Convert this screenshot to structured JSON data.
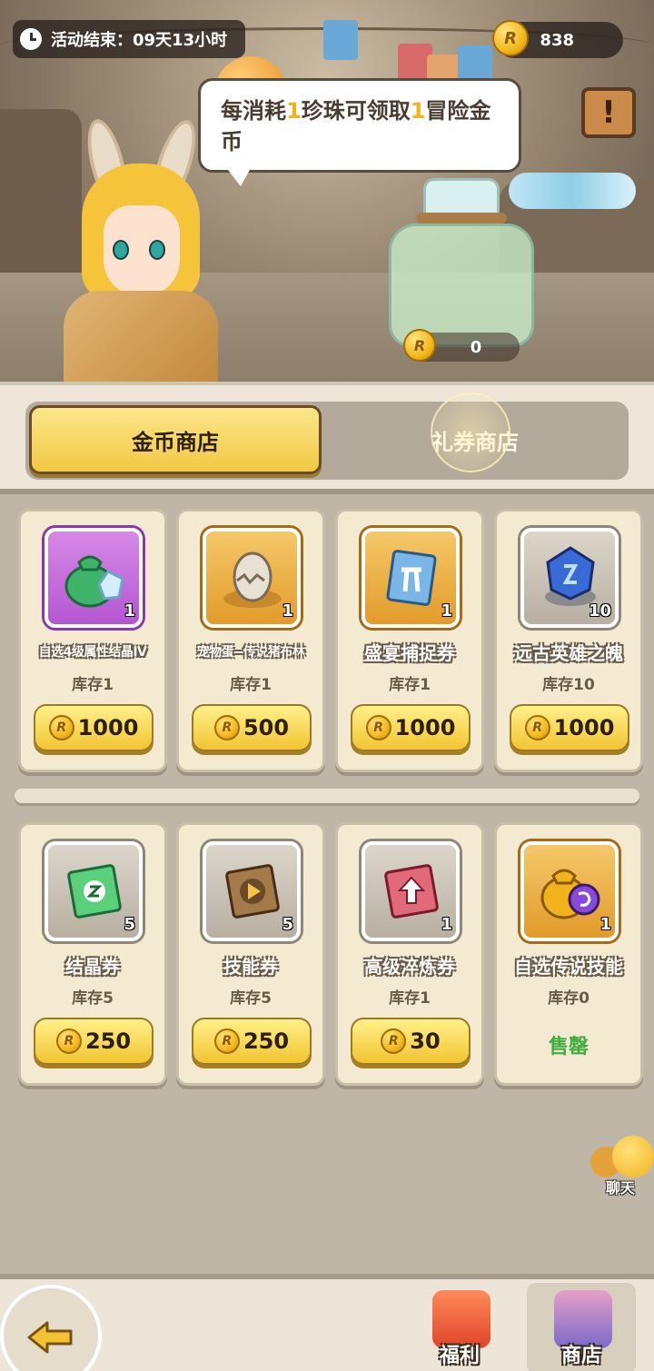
{
  "event": {
    "timer_label": "活动结束：09天13小时"
  },
  "currency": {
    "coin_count": "838"
  },
  "bubble": {
    "part1": "每消耗",
    "num1": "1",
    "part2": "珍珠可领取",
    "num2": "1",
    "part3": "冒险金币"
  },
  "jar": {
    "count": "0"
  },
  "tabs": {
    "coin_shop": "金币商店",
    "voucher_shop": "礼券商店"
  },
  "items": [
    {
      "name": "自选4级属性结晶IV",
      "stock": "库存1",
      "count": "1",
      "price": "1000",
      "frame": "purple",
      "icon": "crystal-bag-icon"
    },
    {
      "name": "宠物蛋--传说猪布林",
      "stock": "库存1",
      "count": "1",
      "price": "500",
      "frame": "gold",
      "icon": "pet-egg-icon"
    },
    {
      "name": "盛宴捕捉券",
      "stock": "库存1",
      "count": "1",
      "price": "1000",
      "frame": "gold",
      "icon": "capture-ticket-icon"
    },
    {
      "name": "远古英雄之魄",
      "stock": "库存10",
      "count": "10",
      "price": "1000",
      "frame": "gray",
      "icon": "hero-soul-icon"
    },
    {
      "name": "结晶券",
      "stock": "库存5",
      "count": "5",
      "price": "250",
      "frame": "gray",
      "icon": "crystal-ticket-icon"
    },
    {
      "name": "技能券",
      "stock": "库存5",
      "count": "5",
      "price": "250",
      "frame": "gray",
      "icon": "skill-ticket-icon"
    },
    {
      "name": "高级淬炼券",
      "stock": "库存1",
      "count": "1",
      "price": "30",
      "frame": "gray",
      "icon": "refine-ticket-icon"
    },
    {
      "name": "自选传说技能",
      "stock": "库存0",
      "count": "1",
      "price": "",
      "soldout": "售罄",
      "frame": "gold",
      "icon": "legend-skill-bag-icon"
    }
  ],
  "chat": {
    "label": "聊天"
  },
  "nav": {
    "welfare": "福利",
    "shop": "商店"
  },
  "colors": {
    "gold": "#f2c532",
    "soldout": "#3fae3f",
    "purple_frame": "#b456d2"
  }
}
